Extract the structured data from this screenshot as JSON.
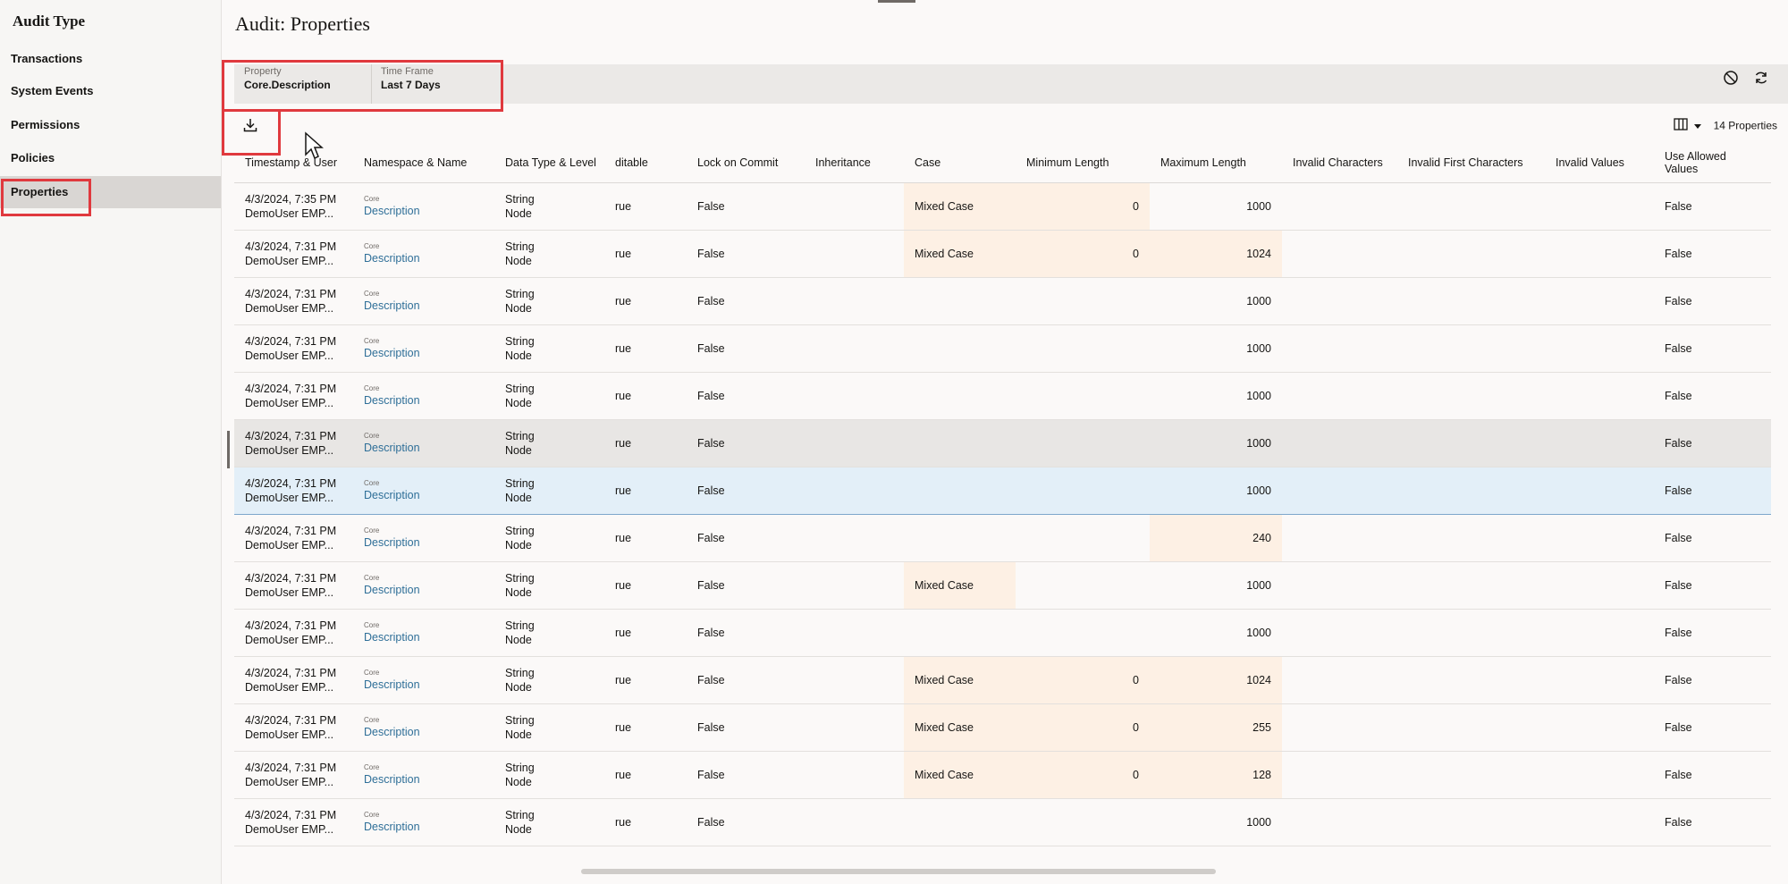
{
  "sidebar": {
    "title": "Audit Type",
    "items": [
      {
        "label": "Transactions"
      },
      {
        "label": "System Events"
      },
      {
        "label": "Permissions"
      },
      {
        "label": "Policies"
      },
      {
        "label": "Properties"
      }
    ],
    "active": "Properties"
  },
  "page": {
    "title": "Audit: Properties"
  },
  "filters": {
    "property": {
      "label": "Property",
      "value": "Core.Description"
    },
    "time_frame": {
      "label": "Time Frame",
      "value": "Last 7 Days"
    }
  },
  "toolbar": {
    "download_icon": "download-icon",
    "clear_icon": "clear-filter-icon",
    "refresh_icon": "refresh-icon",
    "columns_icon": "columns-icon",
    "count_label": "14 Properties"
  },
  "table": {
    "columns": [
      "Timestamp & User",
      "Namespace & Name",
      "Data Type & Level",
      "Editable",
      "Lock on Commit",
      "Inheritance",
      "Case",
      "Minimum Length",
      "Maximum Length",
      "Invalid Characters",
      "Invalid First Characters",
      "Invalid Values",
      "Use Allowed Values"
    ],
    "columns_shown": [
      "Timestamp & User",
      "Namespace & Name",
      "Data Type & Level",
      "ditable",
      "Lock on Commit",
      "Inheritance",
      "Case",
      "Minimum Length",
      "Maximum Length",
      "Invalid Characters",
      "Invalid First Characters",
      "Invalid Values",
      "Use Allowed Values"
    ],
    "rows": [
      {
        "ts": "4/3/2024, 7:35 PM",
        "user": "DemoUser EMP...",
        "ns": "Core",
        "name": "Description",
        "type": "String",
        "level": "Node",
        "editable": "rue",
        "lock": "False",
        "inherit": "",
        "case": "Mixed Case",
        "min": "0",
        "max": "1000",
        "invchar": "",
        "invfirst": "",
        "invval": "",
        "allowed": "False",
        "hl": [
          "case",
          "min"
        ]
      },
      {
        "ts": "4/3/2024, 7:31 PM",
        "user": "DemoUser EMP...",
        "ns": "Core",
        "name": "Description",
        "type": "String",
        "level": "Node",
        "editable": "rue",
        "lock": "False",
        "inherit": "",
        "case": "Mixed Case",
        "min": "0",
        "max": "1024",
        "invchar": "",
        "invfirst": "",
        "invval": "",
        "allowed": "False",
        "hl": [
          "case",
          "min",
          "max"
        ]
      },
      {
        "ts": "4/3/2024, 7:31 PM",
        "user": "DemoUser EMP...",
        "ns": "Core",
        "name": "Description",
        "type": "String",
        "level": "Node",
        "editable": "rue",
        "lock": "False",
        "inherit": "",
        "case": "",
        "min": "",
        "max": "1000",
        "invchar": "",
        "invfirst": "",
        "invval": "",
        "allowed": "False",
        "hl": []
      },
      {
        "ts": "4/3/2024, 7:31 PM",
        "user": "DemoUser EMP...",
        "ns": "Core",
        "name": "Description",
        "type": "String",
        "level": "Node",
        "editable": "rue",
        "lock": "False",
        "inherit": "",
        "case": "",
        "min": "",
        "max": "1000",
        "invchar": "",
        "invfirst": "",
        "invval": "",
        "allowed": "False",
        "hl": []
      },
      {
        "ts": "4/3/2024, 7:31 PM",
        "user": "DemoUser EMP...",
        "ns": "Core",
        "name": "Description",
        "type": "String",
        "level": "Node",
        "editable": "rue",
        "lock": "False",
        "inherit": "",
        "case": "",
        "min": "",
        "max": "1000",
        "invchar": "",
        "invfirst": "",
        "invval": "",
        "allowed": "False",
        "hl": []
      },
      {
        "ts": "4/3/2024, 7:31 PM",
        "user": "DemoUser EMP...",
        "ns": "Core",
        "name": "Description",
        "type": "String",
        "level": "Node",
        "editable": "rue",
        "lock": "False",
        "inherit": "",
        "case": "",
        "min": "",
        "max": "1000",
        "invchar": "",
        "invfirst": "",
        "invval": "",
        "allowed": "False",
        "hl": [],
        "state": "hover"
      },
      {
        "ts": "4/3/2024, 7:31 PM",
        "user": "DemoUser EMP...",
        "ns": "Core",
        "name": "Description",
        "type": "String",
        "level": "Node",
        "editable": "rue",
        "lock": "False",
        "inherit": "",
        "case": "",
        "min": "",
        "max": "1000",
        "invchar": "",
        "invfirst": "",
        "invval": "",
        "allowed": "False",
        "hl": [],
        "state": "selected"
      },
      {
        "ts": "4/3/2024, 7:31 PM",
        "user": "DemoUser EMP...",
        "ns": "Core",
        "name": "Description",
        "type": "String",
        "level": "Node",
        "editable": "rue",
        "lock": "False",
        "inherit": "",
        "case": "",
        "min": "",
        "max": "240",
        "invchar": "",
        "invfirst": "",
        "invval": "",
        "allowed": "False",
        "hl": [
          "max"
        ]
      },
      {
        "ts": "4/3/2024, 7:31 PM",
        "user": "DemoUser EMP...",
        "ns": "Core",
        "name": "Description",
        "type": "String",
        "level": "Node",
        "editable": "rue",
        "lock": "False",
        "inherit": "",
        "case": "Mixed Case",
        "min": "",
        "max": "1000",
        "invchar": "",
        "invfirst": "",
        "invval": "",
        "allowed": "False",
        "hl": [
          "case"
        ]
      },
      {
        "ts": "4/3/2024, 7:31 PM",
        "user": "DemoUser EMP...",
        "ns": "Core",
        "name": "Description",
        "type": "String",
        "level": "Node",
        "editable": "rue",
        "lock": "False",
        "inherit": "",
        "case": "",
        "min": "",
        "max": "1000",
        "invchar": "",
        "invfirst": "",
        "invval": "",
        "allowed": "False",
        "hl": []
      },
      {
        "ts": "4/3/2024, 7:31 PM",
        "user": "DemoUser EMP...",
        "ns": "Core",
        "name": "Description",
        "type": "String",
        "level": "Node",
        "editable": "rue",
        "lock": "False",
        "inherit": "",
        "case": "Mixed Case",
        "min": "0",
        "max": "1024",
        "invchar": "",
        "invfirst": "",
        "invval": "",
        "allowed": "False",
        "hl": [
          "case",
          "min",
          "max"
        ]
      },
      {
        "ts": "4/3/2024, 7:31 PM",
        "user": "DemoUser EMP...",
        "ns": "Core",
        "name": "Description",
        "type": "String",
        "level": "Node",
        "editable": "rue",
        "lock": "False",
        "inherit": "",
        "case": "Mixed Case",
        "min": "0",
        "max": "255",
        "invchar": "",
        "invfirst": "",
        "invval": "",
        "allowed": "False",
        "hl": [
          "case",
          "min",
          "max"
        ]
      },
      {
        "ts": "4/3/2024, 7:31 PM",
        "user": "DemoUser EMP...",
        "ns": "Core",
        "name": "Description",
        "type": "String",
        "level": "Node",
        "editable": "rue",
        "lock": "False",
        "inherit": "",
        "case": "Mixed Case",
        "min": "0",
        "max": "128",
        "invchar": "",
        "invfirst": "",
        "invval": "",
        "allowed": "False",
        "hl": [
          "case",
          "min",
          "max"
        ]
      },
      {
        "ts": "4/3/2024, 7:31 PM",
        "user": "DemoUser EMP...",
        "ns": "Core",
        "name": "Description",
        "type": "String",
        "level": "Node",
        "editable": "rue",
        "lock": "False",
        "inherit": "",
        "case": "",
        "min": "",
        "max": "1000",
        "invchar": "",
        "invfirst": "",
        "invval": "",
        "allowed": "False",
        "hl": []
      }
    ]
  },
  "colors": {
    "highlight": "#fdf0e4",
    "selected_row": "#e3eff8",
    "link": "#2f6f98",
    "callout": "#e0393e"
  }
}
